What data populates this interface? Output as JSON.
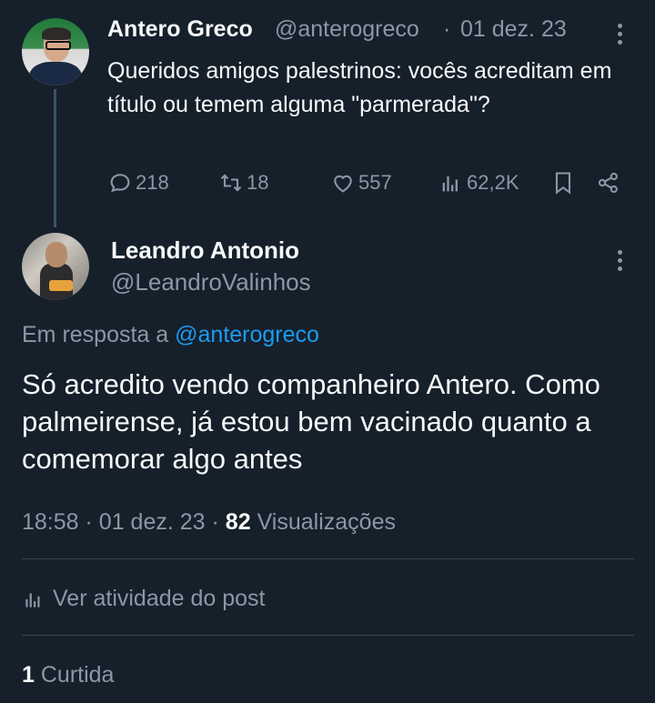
{
  "parent_post": {
    "author_name": "Antero Greco",
    "author_handle": "@anterogreco",
    "separator": "·",
    "date": "01 dez. 23",
    "text": "Queridos amigos palestrinos: vocês acreditam em título ou temem alguma \"parmerada\"?",
    "stats": {
      "replies": "218",
      "reposts": "18",
      "likes": "557",
      "views": "62,2K"
    }
  },
  "reply_post": {
    "author_name": "Leandro Antonio",
    "author_handle": "@LeandroValinhos",
    "reply_prefix": "Em resposta a",
    "reply_mention": "@anterogreco",
    "text": "Só acredito vendo companheiro Antero. Como palmeirense, já estou bem vacinado quanto a comemorar algo antes",
    "time": "18:58",
    "sep1": "·",
    "date": "01 dez. 23",
    "sep2": "·",
    "views_count": "82",
    "views_label": "Visualizações",
    "activity_label": "Ver atividade do post",
    "likes_count": "1",
    "likes_label": "Curtida"
  },
  "colors": {
    "background": "#15202b",
    "text": "#f7f9f9",
    "muted": "#8b98a5",
    "accent": "#1d9bf0",
    "divider": "#38444d"
  },
  "icons": [
    "reply-icon",
    "repost-icon",
    "like-icon",
    "views-icon",
    "bookmark-icon",
    "share-icon",
    "more-icon",
    "activity-icon"
  ]
}
